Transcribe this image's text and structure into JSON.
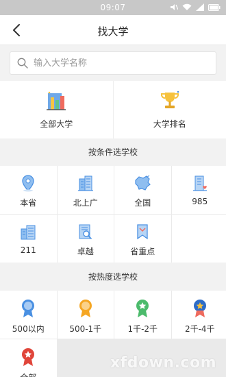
{
  "status_bar": {
    "time": "09:07"
  },
  "header": {
    "title": "找大学"
  },
  "search": {
    "placeholder": "输入大学名称"
  },
  "quick": [
    {
      "label": "全部大学",
      "icon": "all-universities-icon"
    },
    {
      "label": "大学排名",
      "icon": "trophy-icon"
    }
  ],
  "condition": {
    "title": "按条件选学校",
    "items": [
      {
        "label": "本省",
        "icon": "location-pin-icon"
      },
      {
        "label": "北上广",
        "icon": "city-buildings-icon"
      },
      {
        "label": "全国",
        "icon": "china-map-icon"
      },
      {
        "label": "985",
        "icon": "building-heart-icon"
      },
      {
        "label": "211",
        "icon": "buildings-icon"
      },
      {
        "label": "卓越",
        "icon": "document-search-icon"
      },
      {
        "label": "省重点",
        "icon": "bookmark-icon"
      }
    ]
  },
  "popularity": {
    "title": "按热度选学校",
    "items": [
      {
        "label": "500以内",
        "icon": "medal-blue-icon",
        "color": "#4a90e2"
      },
      {
        "label": "500-1千",
        "icon": "medal-orange-icon",
        "color": "#f5a623"
      },
      {
        "label": "1千-2千",
        "icon": "medal-green-icon",
        "color": "#4cbb6c"
      },
      {
        "label": "2千-4千",
        "icon": "medal-navy-icon",
        "color": "#2d6cc8"
      },
      {
        "label": "全部",
        "icon": "medal-red-icon",
        "color": "#e0453a"
      }
    ]
  },
  "watermark": "xfdown.com"
}
